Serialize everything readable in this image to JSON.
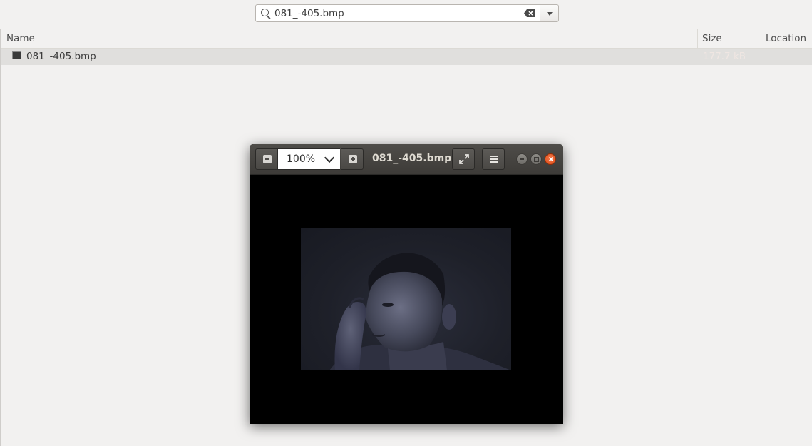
{
  "search": {
    "query": "081_-405.bmp"
  },
  "list": {
    "columns": [
      "Name",
      "Size",
      "Location"
    ],
    "files": [
      {
        "name": "081_-405.bmp",
        "size": "177.7 kB",
        "location": ""
      }
    ]
  },
  "viewer": {
    "zoom": "100%",
    "title": "081_-405.bmp",
    "image_description": "dark image of a man touching his face"
  },
  "colors": {
    "close_button": "#df4b16",
    "viewer_header": "#3d3b38",
    "selected_row": "#e0dfdd"
  },
  "icons": [
    "search-icon",
    "clear-icon",
    "dropdown-icon",
    "image-file-icon",
    "zoom-out-icon",
    "zoom-in-icon",
    "chevron-down-icon",
    "fullscreen-icon",
    "menu-icon",
    "minimize-icon",
    "maximize-icon",
    "close-icon"
  ]
}
